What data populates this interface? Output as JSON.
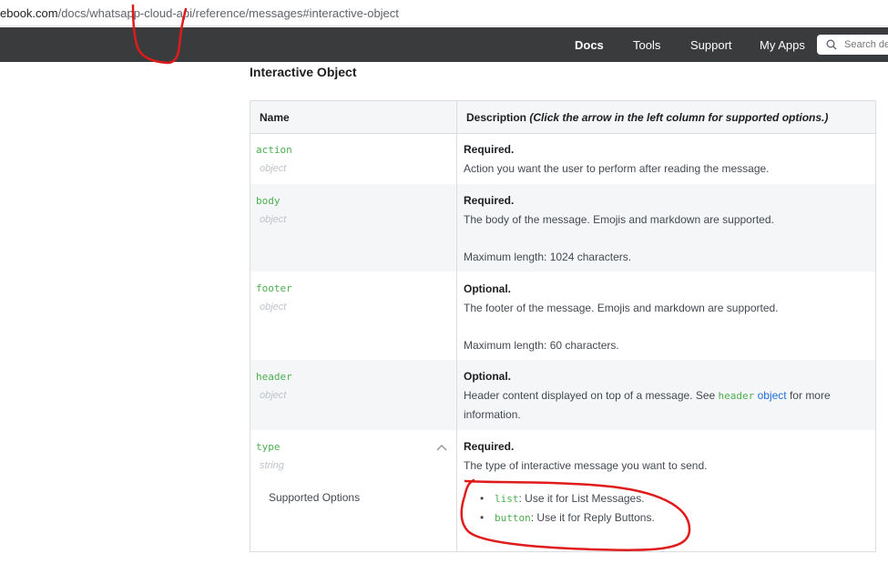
{
  "browser": {
    "url_domain": "ebook.com",
    "url_path": "/docs/whatsapp-cloud-api/reference/messages#interactive-object"
  },
  "nav": {
    "items": [
      "Docs",
      "Tools",
      "Support",
      "My Apps"
    ],
    "search_placeholder": "Search de"
  },
  "section": {
    "title": "Interactive Object"
  },
  "table": {
    "header_name": "Name",
    "header_desc": "Description",
    "header_note": "(Click the arrow in the left column for supported options.)",
    "rows": [
      {
        "name": "action",
        "type": "object",
        "requirement": "Required.",
        "lines": [
          "Action you want the user to perform after reading the message."
        ]
      },
      {
        "name": "body",
        "type": "object",
        "requirement": "Required.",
        "lines": [
          "The body of the message. Emojis and markdown are supported.",
          "Maximum length: 1024 characters."
        ]
      },
      {
        "name": "footer",
        "type": "object",
        "requirement": "Optional.",
        "lines": [
          "The footer of the message. Emojis and markdown are supported.",
          "Maximum length: 60 characters."
        ]
      },
      {
        "name": "header",
        "type": "object",
        "requirement": "Optional.",
        "line_pre": "Header content displayed on top of a message. See ",
        "line_code": "header",
        "line_link": "object",
        "line_post": " for more",
        "line2": "information."
      },
      {
        "name": "type",
        "type": "string",
        "requirement": "Required.",
        "lines": [
          "The type of interactive message you want to send."
        ],
        "supported_label": "Supported Options",
        "options": [
          {
            "code": "list",
            "text": ": Use it for List Messages."
          },
          {
            "code": "button",
            "text": ": Use it for Reply Buttons."
          }
        ]
      }
    ]
  },
  "colors": {
    "nav_bg": "#3a3b3c",
    "field_name": "#4caf50",
    "link": "#216fdb",
    "annotation": "#e01b1b"
  }
}
